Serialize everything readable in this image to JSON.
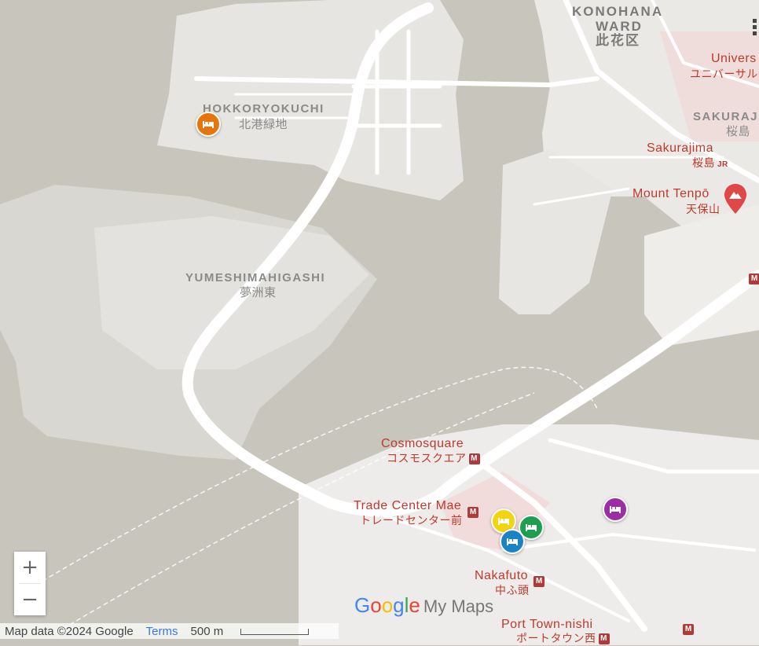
{
  "labels": {
    "hokkoryokuchi_en": "HOKKORYOKUCHI",
    "hokkoryokuchi_jp": "北港緑地",
    "yumeshima_en": "YUMESHIMAHIGASHI",
    "yumeshima_jp": "夢洲東",
    "konohana_en_1": "KONOHANA",
    "konohana_en_2": "WARD",
    "konohana_jp": "此花区",
    "universal_en": "Univers",
    "universal_jp": "ユニバーサル",
    "sakurajima_area_en": "SAKURAJ",
    "sakurajima_area_jp": "桜島",
    "sakurajima_st_en": "Sakurajima",
    "sakurajima_st_jp": "桜島",
    "tempo_en": "Mount Tenpō",
    "tempo_jp": "天保山",
    "cosmosquare_en": "Cosmosquare",
    "cosmosquare_jp": "コスモスクエア",
    "trade_en": "Trade Center Mae",
    "trade_jp": "トレードセンター前",
    "nakafuto_en": "Nakafuto",
    "nakafuto_jp": "中ふ頭",
    "porttown_en": "Port Town-nishi",
    "porttown_jp": "ポートタウン西"
  },
  "markers": [
    {
      "name": "hotel-marker-orange",
      "color": "#e8740c"
    },
    {
      "name": "hotel-marker-yellow",
      "color": "#f2d50f"
    },
    {
      "name": "hotel-marker-green",
      "color": "#1e9e4f"
    },
    {
      "name": "hotel-marker-blue",
      "color": "#1a82c6"
    },
    {
      "name": "hotel-marker-purple",
      "color": "#9b2ea5"
    }
  ],
  "controls": {
    "zoom_in": "+",
    "zoom_out": "−"
  },
  "footer": {
    "map_data": "Map data ©2024 Google",
    "terms": "Terms",
    "scale": "500 m"
  },
  "logo": {
    "google": "Google",
    "my_maps": "My Maps"
  },
  "icons": {
    "station": "metro-station-icon",
    "marker": "bed-icon",
    "mountain": "mountain-icon"
  }
}
